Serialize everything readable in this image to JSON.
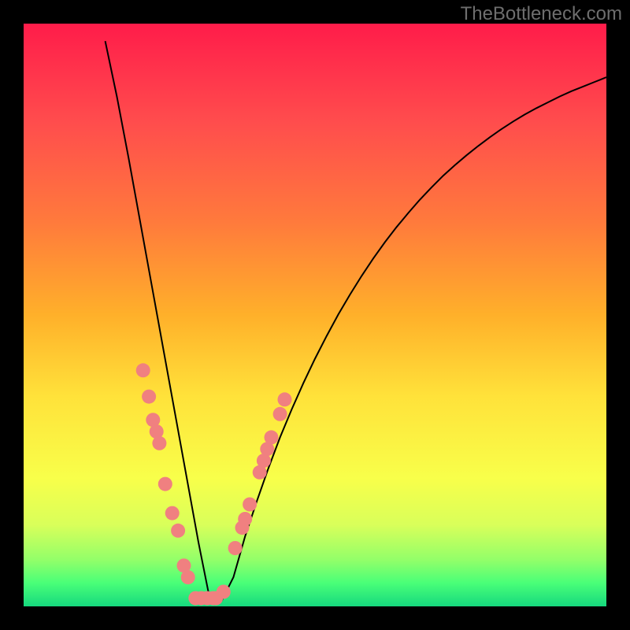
{
  "watermark": "TheBottleneck.com",
  "colors": {
    "frame": "#000000",
    "curve": "#000000",
    "marker_fill": "#f08080",
    "marker_stroke": "#cc4040"
  },
  "chart_data": {
    "type": "line",
    "title": "",
    "xlabel": "",
    "ylabel": "",
    "xlim": [
      0,
      100
    ],
    "ylim": [
      0,
      100
    ],
    "grid": false,
    "note": "V-shaped bottleneck curve; y is mismatch %, minimum near x≈28-34; values estimated from pixels",
    "x": [
      0,
      2,
      4,
      6,
      8,
      10,
      12,
      14,
      16,
      18,
      20,
      22,
      24,
      26,
      28,
      30,
      32,
      34,
      36,
      38,
      40,
      42,
      44,
      46,
      48,
      50,
      52,
      54,
      56,
      58,
      60,
      62,
      64,
      66,
      68,
      70,
      72,
      74,
      76,
      78,
      80,
      82,
      84,
      86,
      88,
      90,
      92,
      94,
      96,
      98,
      100
    ],
    "values": [
      100,
      100,
      100,
      100,
      100,
      100,
      100,
      97,
      87.5,
      77,
      66,
      55,
      44,
      33,
      22,
      11,
      1,
      1,
      5,
      12,
      18,
      23.7,
      29,
      33.8,
      38.3,
      42.5,
      46.4,
      50.1,
      53.5,
      56.7,
      59.7,
      62.5,
      65.1,
      67.5,
      69.8,
      71.9,
      73.9,
      75.7,
      77.4,
      79,
      80.5,
      81.9,
      83.2,
      84.4,
      85.5,
      86.5,
      87.5,
      88.4,
      89.2,
      90,
      90.8
    ],
    "markers": {
      "type": "scatter",
      "note": "salmon highlight markers along lower V region",
      "points": [
        {
          "x": 20.5,
          "y": 40.5
        },
        {
          "x": 21.5,
          "y": 36
        },
        {
          "x": 22.2,
          "y": 32
        },
        {
          "x": 22.8,
          "y": 30
        },
        {
          "x": 23.3,
          "y": 28
        },
        {
          "x": 24.3,
          "y": 21
        },
        {
          "x": 25.5,
          "y": 16
        },
        {
          "x": 26.5,
          "y": 13
        },
        {
          "x": 27.5,
          "y": 7
        },
        {
          "x": 28.2,
          "y": 5
        },
        {
          "x": 29.5,
          "y": 1.4
        },
        {
          "x": 30.5,
          "y": 1.4
        },
        {
          "x": 31.5,
          "y": 1.4
        },
        {
          "x": 32.5,
          "y": 1.4
        },
        {
          "x": 33,
          "y": 1.4
        },
        {
          "x": 34.3,
          "y": 2.5
        },
        {
          "x": 36.3,
          "y": 10
        },
        {
          "x": 37.5,
          "y": 13.5
        },
        {
          "x": 38,
          "y": 15
        },
        {
          "x": 38.8,
          "y": 17.5
        },
        {
          "x": 40.5,
          "y": 23
        },
        {
          "x": 41.2,
          "y": 25
        },
        {
          "x": 41.8,
          "y": 27
        },
        {
          "x": 42.5,
          "y": 29
        },
        {
          "x": 44,
          "y": 33
        },
        {
          "x": 44.8,
          "y": 35.5
        }
      ]
    }
  }
}
